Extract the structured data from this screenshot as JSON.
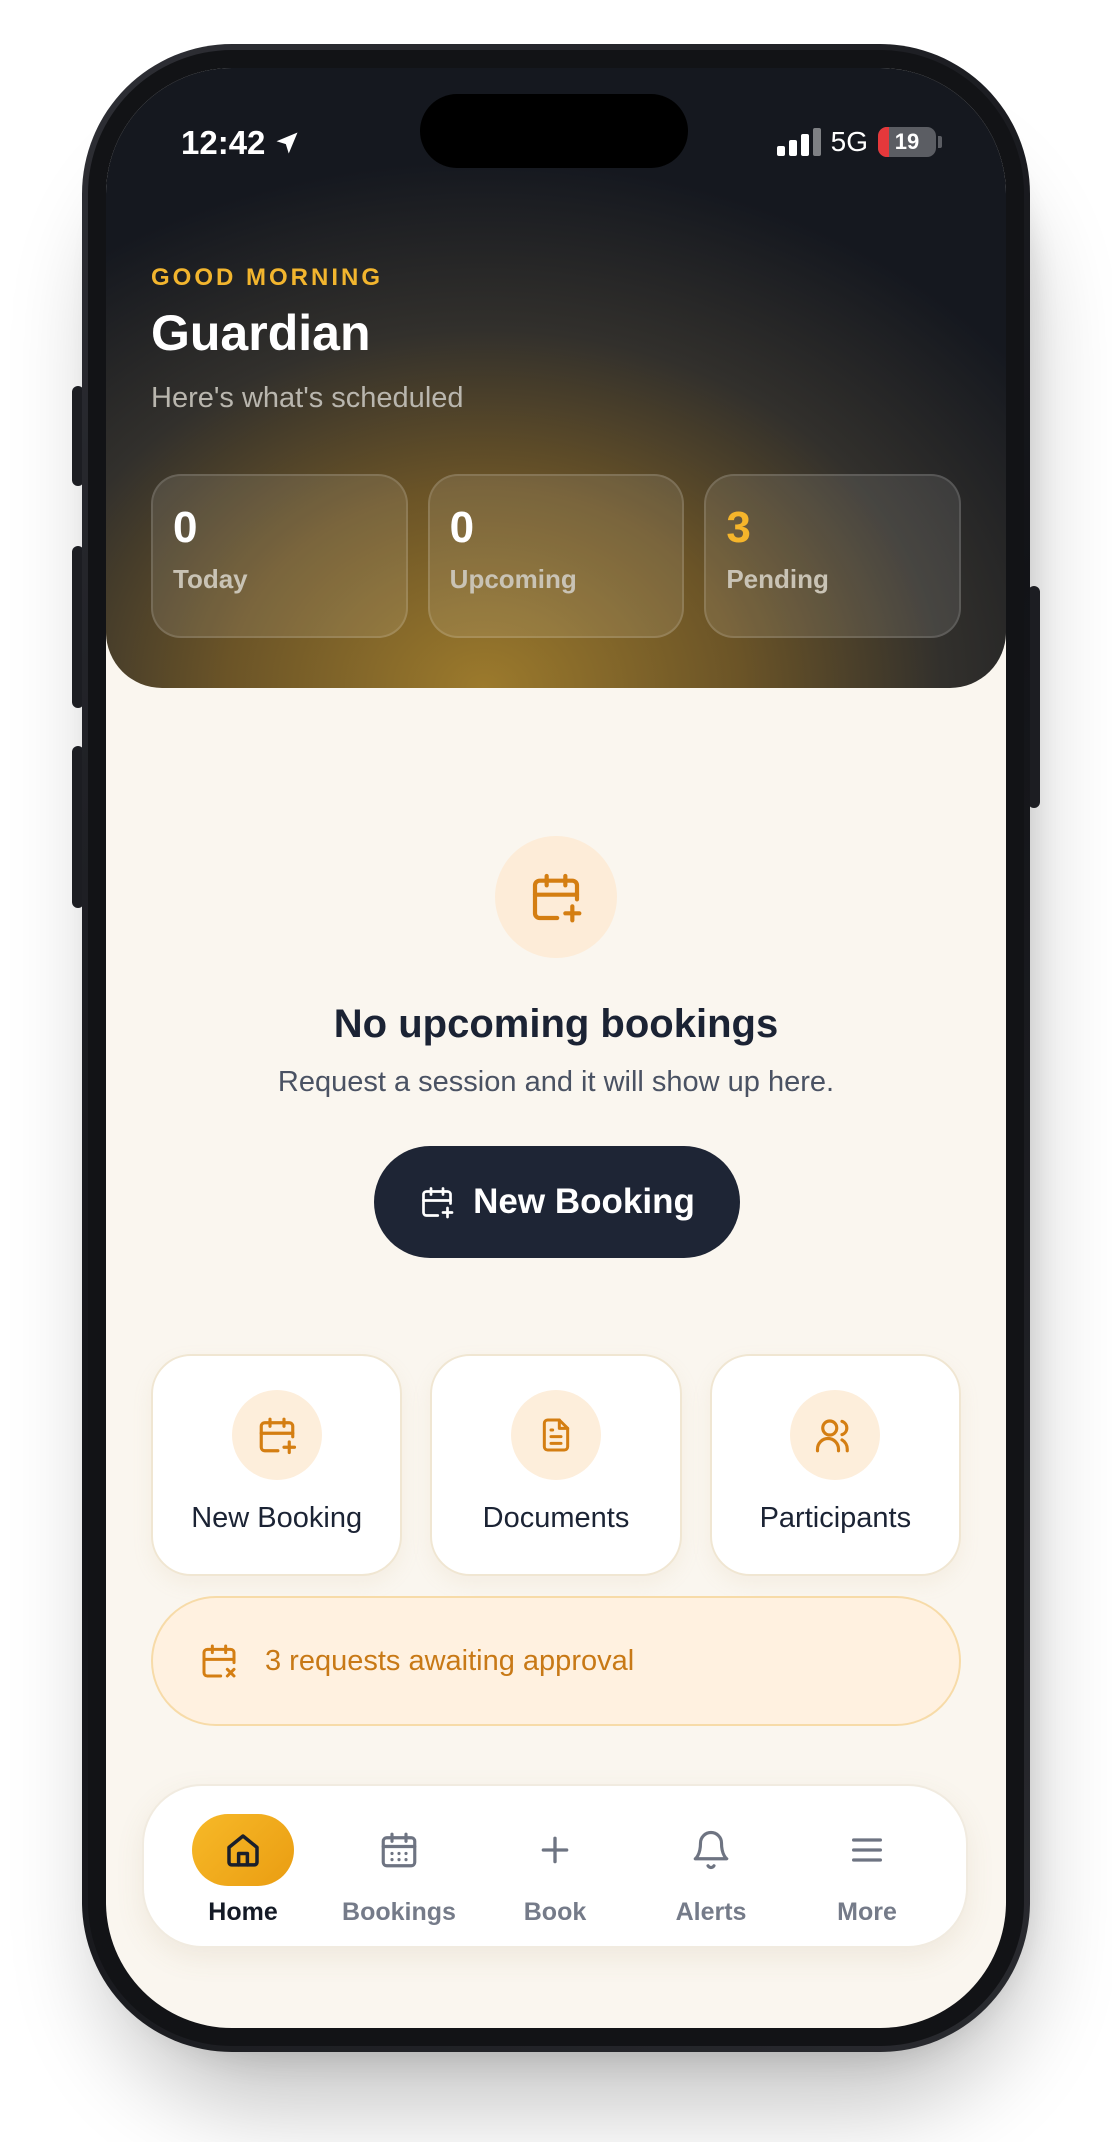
{
  "status_bar": {
    "time": "12:42",
    "network": "5G",
    "battery": "19",
    "battery_level": 0.19
  },
  "header": {
    "greeting": "GOOD MORNING",
    "name": "Guardian",
    "subtitle": "Here's what's scheduled"
  },
  "stats": [
    {
      "value": "0",
      "label": "Today"
    },
    {
      "value": "0",
      "label": "Upcoming"
    },
    {
      "value": "3",
      "label": "Pending"
    }
  ],
  "empty_state": {
    "title": "No upcoming bookings",
    "subtitle": "Request a session and it will show up here.",
    "button_label": "New Booking",
    "icon": "calendar-plus-icon"
  },
  "quick_actions": [
    {
      "label": "New Booking",
      "icon": "calendar-plus-icon"
    },
    {
      "label": "Documents",
      "icon": "document-icon"
    },
    {
      "label": "Participants",
      "icon": "users-icon"
    }
  ],
  "banner": {
    "text": "3 requests awaiting approval",
    "icon": "calendar-x-icon"
  },
  "tabs": [
    {
      "label": "Home",
      "icon": "home-icon",
      "active": true
    },
    {
      "label": "Bookings",
      "icon": "calendar-icon",
      "active": false
    },
    {
      "label": "Book",
      "icon": "plus-icon",
      "active": false
    },
    {
      "label": "Alerts",
      "icon": "bell-icon",
      "active": false
    },
    {
      "label": "More",
      "icon": "menu-icon",
      "active": false
    }
  ],
  "colors": {
    "accent": "#F5B52B",
    "accent_text": "#C87916",
    "dark_button": "#1E2535",
    "background": "#FAF6EF"
  }
}
